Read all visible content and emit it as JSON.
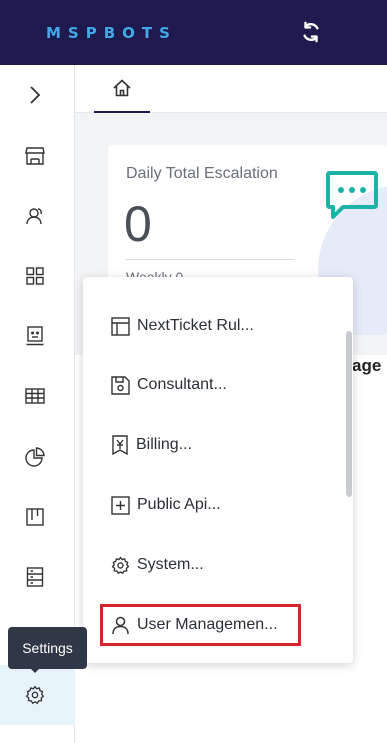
{
  "header": {
    "logo_text": "MSPBOTS",
    "sync_icon": "sync-icon"
  },
  "sidebar": {
    "items": [
      {
        "icon": "chevron-right-icon"
      },
      {
        "icon": "store-icon"
      },
      {
        "icon": "users-icon"
      },
      {
        "icon": "grid-icon"
      },
      {
        "icon": "bot-icon"
      },
      {
        "icon": "table-icon"
      },
      {
        "icon": "pie-chart-icon"
      },
      {
        "icon": "kanban-icon"
      },
      {
        "icon": "server-icon"
      },
      {
        "icon": "gear-icon",
        "active": true
      }
    ],
    "tooltip": "Settings"
  },
  "tabs": [
    {
      "icon": "home-icon"
    }
  ],
  "card": {
    "title": "Daily Total Escalation",
    "value": "0",
    "subtitle": "Weekly 0",
    "icon": "chat-icon"
  },
  "partial_text": "age",
  "settings_menu": {
    "items": [
      {
        "label": "NextTicket Rul...",
        "icon": "layout-icon"
      },
      {
        "label": "Consultant...",
        "icon": "save-icon"
      },
      {
        "label": "Billing...",
        "icon": "billing-icon"
      },
      {
        "label": "Public Api...",
        "icon": "plus-square-icon"
      },
      {
        "label": "System...",
        "icon": "gear-icon"
      },
      {
        "label": "User Managemen...",
        "icon": "user-icon",
        "highlighted": true
      }
    ]
  },
  "colors": {
    "header_bg": "#1f1a4e",
    "logo": "#42a9e8",
    "highlight_border": "#d6262d",
    "chat_icon": "#1ab3a6",
    "tooltip_bg": "#303848"
  }
}
